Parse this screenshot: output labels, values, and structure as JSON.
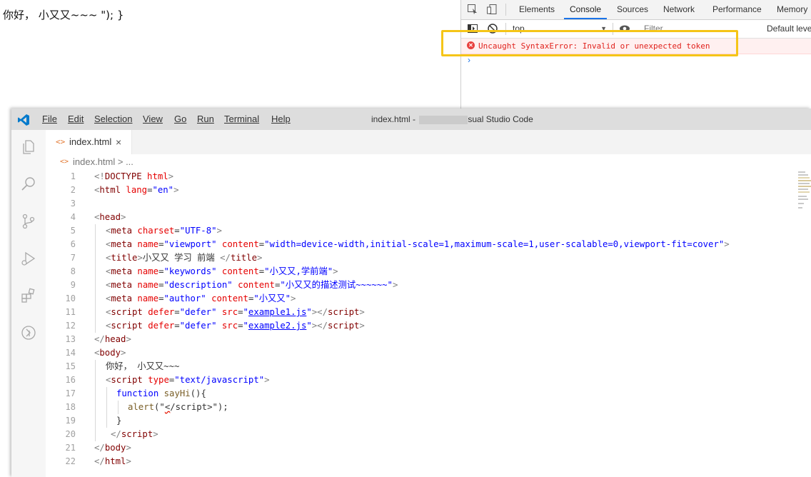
{
  "page": {
    "text": "你好， 小又又~~~ \"); }"
  },
  "devtools": {
    "tabs": [
      {
        "label": "Elements"
      },
      {
        "label": "Console",
        "active": true
      },
      {
        "label": "Sources"
      },
      {
        "label": "Network"
      },
      {
        "label": "Performance"
      },
      {
        "label": "Memory"
      }
    ],
    "context": "top",
    "filter_placeholder": "Filter",
    "levels": "Default levels",
    "error_message": "Uncaught SyntaxError: Invalid or unexpected token",
    "prompt": "›",
    "colors": {
      "error": "#e0211c",
      "error_bg": "#fff0f0",
      "highlight": "#f5c518",
      "accent": "#1a73e8"
    }
  },
  "vscode": {
    "menu": [
      "File",
      "Edit",
      "Selection",
      "View",
      "Go",
      "Run",
      "Terminal",
      "Help"
    ],
    "title_prefix": "index.html - ",
    "title_suffix": "sual Studio Code",
    "tab": {
      "label": "index.html",
      "close": "×",
      "icon": "<>"
    },
    "breadcrumb": {
      "icon": "<>",
      "text": "index.html > ..."
    },
    "activity_icons": [
      "explorer-icon",
      "search-icon",
      "source-control-icon",
      "run-debug-icon",
      "extensions-icon",
      "remote-icon"
    ],
    "line_numbers": [
      "1",
      "2",
      "3",
      "4",
      "5",
      "6",
      "7",
      "8",
      "9",
      "10",
      "11",
      "12",
      "13",
      "14",
      "15",
      "16",
      "17",
      "18",
      "19",
      "20",
      "21",
      "22"
    ],
    "code": {
      "l1": {
        "a": "<!",
        "b": "DOCTYPE",
        "c": " html",
        "d": ">"
      },
      "l2": {
        "a": "<",
        "b": "html",
        "c": " lang",
        "d": "=",
        "e": "\"en\"",
        "f": ">"
      },
      "l4": {
        "a": "<",
        "b": "head",
        "c": ">"
      },
      "l5": {
        "a": "<",
        "b": "meta",
        "c": " charset",
        "d": "=",
        "e": "\"UTF-8\"",
        "f": ">"
      },
      "l6": {
        "a": "<",
        "b": "meta",
        "c": " name",
        "d": "=",
        "e": "\"viewport\"",
        "f": " content",
        "g": "=",
        "h": "\"width=device-width,initial-scale=1,maximum-scale=1,user-scalable=0,viewport-fit=cover\"",
        "i": ">"
      },
      "l7": {
        "a": "<",
        "b": "title",
        "c": ">",
        "d": "小又又 学习 前端 ",
        "e": "</",
        "f": "title",
        "g": ">"
      },
      "l8": {
        "a": "<",
        "b": "meta",
        "c": " name",
        "d": "=",
        "e": "\"keywords\"",
        "f": " content",
        "g": "=",
        "h": "\"小又又,学前端\"",
        "i": ">"
      },
      "l9": {
        "a": "<",
        "b": "meta",
        "c": " name",
        "d": "=",
        "e": "\"description\"",
        "f": " content",
        "g": "=",
        "h": "\"小又又的描述测试~~~~~~\"",
        "i": ">"
      },
      "l10": {
        "a": "<",
        "b": "meta",
        "c": " name",
        "d": "=",
        "e": "\"author\"",
        "f": " content",
        "g": "=",
        "h": "\"小又又\"",
        "i": ">"
      },
      "l11": {
        "a": "<",
        "b": "script",
        "c": " defer",
        "d": "=",
        "e": "\"defer\"",
        "f": " src",
        "g": "=",
        "h": "\"",
        "i": "example1.js",
        "j": "\"",
        "k": "></",
        "l": "script",
        "m": ">"
      },
      "l12": {
        "a": "<",
        "b": "script",
        "c": " defer",
        "d": "=",
        "e": "\"defer\"",
        "f": " src",
        "g": "=",
        "h": "\"",
        "i": "example2.js",
        "j": "\"",
        "k": "></",
        "l": "script",
        "m": ">"
      },
      "l13": {
        "a": "</",
        "b": "head",
        "c": ">"
      },
      "l14": {
        "a": "<",
        "b": "body",
        "c": ">"
      },
      "l15": {
        "a": "你好， 小又又~~~"
      },
      "l16": {
        "a": "<",
        "b": "script",
        "c": " type",
        "d": "=",
        "e": "\"text/javascript\"",
        "f": ">"
      },
      "l17": {
        "a": "function",
        "b": " sayHi",
        "c": "(){"
      },
      "l18": {
        "a": "alert",
        "b": "(\"",
        "c": "<",
        "d": "/script>\"",
        "e": ");"
      },
      "l19": {
        "a": "}"
      },
      "l20": {
        "a": "</",
        "b": "script",
        "c": ">"
      },
      "l21": {
        "a": "</",
        "b": "body",
        "c": ">"
      },
      "l22": {
        "a": "</",
        "b": "html",
        "c": ">"
      }
    }
  }
}
